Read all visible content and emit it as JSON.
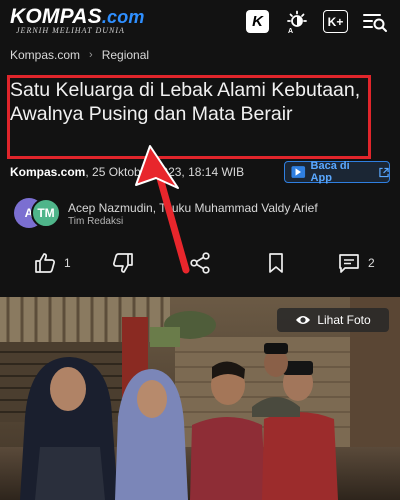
{
  "header": {
    "logo_main": "KOMPAS",
    "logo_dot": ".com",
    "logo_tagline": "JERNIH MELIHAT DUNIA",
    "k_label": "K",
    "kplus_label": "K+"
  },
  "breadcrumb": [
    "Kompas.com",
    "Regional"
  ],
  "article": {
    "title": "Satu Keluarga di Lebak Alami Kebutaan, Awalnya Pusing dan Mata Berair",
    "source": "Kompas.com",
    "date": ", 25 Oktober 2023, 18:14 WIB",
    "baca_label": "Baca di App",
    "authors": "Acep Nazmudin,  Teuku Muhammad Valdy Arief",
    "team": "Tim Redaksi",
    "avatar_1": "A",
    "avatar_2": "TM"
  },
  "actions": {
    "like_count": "1",
    "comment_count": "2"
  },
  "photo": {
    "view_label": "Lihat Foto"
  },
  "colors": {
    "accent": "#2f8fff",
    "highlight": "#e0252b"
  }
}
